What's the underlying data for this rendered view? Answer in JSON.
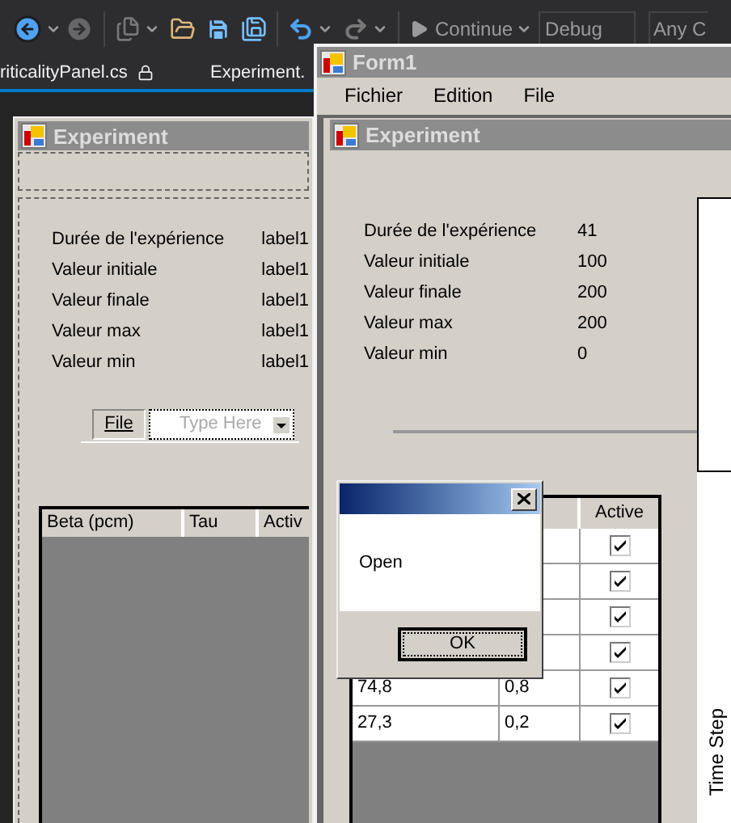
{
  "ide": {
    "toolbar": {
      "continue_label": "Continue",
      "configuration": "Debug",
      "platform": "Any C"
    },
    "tabs": [
      {
        "label": "riticalityPanel.cs",
        "locked": true
      },
      {
        "label": "Experiment.",
        "locked": false
      }
    ]
  },
  "designer": {
    "title": "Experiment",
    "fields": [
      {
        "label": "Durée de l'expérience",
        "value": "label1"
      },
      {
        "label": "Valeur initiale",
        "value": "label1"
      },
      {
        "label": "Valeur finale",
        "value": "label1"
      },
      {
        "label": "Valeur max",
        "value": "label1"
      },
      {
        "label": "Valeur min",
        "value": "label1"
      }
    ],
    "menu_strip": {
      "item": "File",
      "placeholder": "Type Here"
    },
    "grid": {
      "columns": [
        "Beta (pcm)",
        "Tau",
        "Activ"
      ]
    }
  },
  "form1": {
    "title": "Form1",
    "menu": [
      "Fichier",
      "Edition",
      "File"
    ],
    "child": {
      "title": "Experiment",
      "fields": [
        {
          "label": "Durée de l'expérience",
          "value": "41"
        },
        {
          "label": "Valeur initiale",
          "value": "100"
        },
        {
          "label": "Valeur finale",
          "value": "200"
        },
        {
          "label": "Valeur max",
          "value": "200"
        },
        {
          "label": "Valeur min",
          "value": "0"
        }
      ],
      "grid": {
        "active_column": "Active",
        "rows": [
          {
            "active": true
          },
          {
            "active": true
          },
          {
            "active": true
          },
          {
            "active": true
          },
          {
            "beta": "74,8",
            "tau": "0,8",
            "active": true
          },
          {
            "beta": "27,3",
            "tau": "0,2",
            "active": true
          }
        ]
      },
      "chart": {
        "axis_label": "Time Step"
      }
    }
  },
  "dialog": {
    "message": "Open",
    "button": "OK"
  }
}
